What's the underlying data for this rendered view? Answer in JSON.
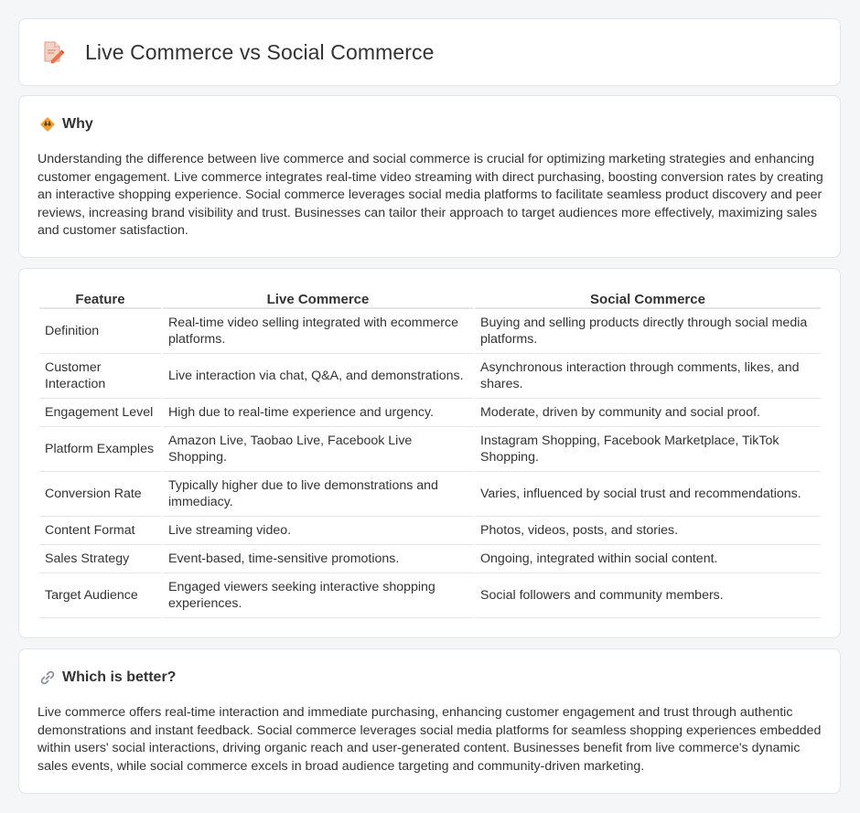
{
  "header": {
    "title": "Live Commerce vs Social Commerce",
    "icon": "document-pencil-icon"
  },
  "why": {
    "icon": "lightbulb-icon",
    "title": "Why",
    "text": "Understanding the difference between live commerce and social commerce is crucial for optimizing marketing strategies and enhancing customer engagement. Live commerce integrates real-time video streaming with direct purchasing, boosting conversion rates by creating an interactive shopping experience. Social commerce leverages social media platforms to facilitate seamless product discovery and peer reviews, increasing brand visibility and trust. Businesses can tailor their approach to target audiences more effectively, maximizing sales and customer satisfaction."
  },
  "comparison": {
    "headers": [
      "Feature",
      "Live Commerce",
      "Social Commerce"
    ],
    "rows": [
      {
        "feature": "Definition",
        "live": "Real-time video selling integrated with ecommerce platforms.",
        "social": "Buying and selling products directly through social media platforms."
      },
      {
        "feature": "Customer Interaction",
        "live": "Live interaction via chat, Q&A, and demonstrations.",
        "social": "Asynchronous interaction through comments, likes, and shares."
      },
      {
        "feature": "Engagement Level",
        "live": "High due to real-time experience and urgency.",
        "social": "Moderate, driven by community and social proof."
      },
      {
        "feature": "Platform Examples",
        "live": "Amazon Live, Taobao Live, Facebook Live Shopping.",
        "social": "Instagram Shopping, Facebook Marketplace, TikTok Shopping."
      },
      {
        "feature": "Conversion Rate",
        "live": "Typically higher due to live demonstrations and immediacy.",
        "social": "Varies, influenced by social trust and recommendations."
      },
      {
        "feature": "Content Format",
        "live": "Live streaming video.",
        "social": "Photos, videos, posts, and stories."
      },
      {
        "feature": "Sales Strategy",
        "live": "Event-based, time-sensitive promotions.",
        "social": "Ongoing, integrated within social content."
      },
      {
        "feature": "Target Audience",
        "live": "Engaged viewers seeking interactive shopping experiences.",
        "social": "Social followers and community members."
      }
    ]
  },
  "better": {
    "icon": "link-icon",
    "title": "Which is better?",
    "text": "Live commerce offers real-time interaction and immediate purchasing, enhancing customer engagement and trust through authentic demonstrations and instant feedback. Social commerce leverages social media platforms for seamless shopping experiences embedded within users' social interactions, driving organic reach and user-generated content. Businesses benefit from live commerce's dynamic sales events, while social commerce excels in broad audience targeting and community-driven marketing."
  },
  "colors": {
    "background": "#f5f6f8",
    "card": "#ffffff",
    "icon_accent": "#e8734a",
    "bulb": "#f0a030"
  }
}
